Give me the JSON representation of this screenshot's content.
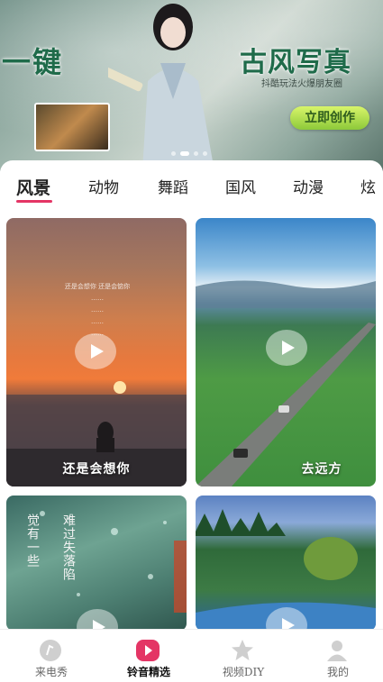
{
  "banner": {
    "title_left": "一键",
    "title_right": "古风写真",
    "subtitle": "抖酷玩法火爆朋友圈",
    "cta": "立即创作",
    "page_index": 2,
    "page_count": 4
  },
  "tabs": [
    {
      "label": "风景",
      "active": true
    },
    {
      "label": "动物",
      "active": false
    },
    {
      "label": "舞蹈",
      "active": false
    },
    {
      "label": "国风",
      "active": false
    },
    {
      "label": "动漫",
      "active": false
    },
    {
      "label": "炫",
      "active": false
    }
  ],
  "cards": [
    {
      "caption": "还是会想你",
      "poem": [
        "还是会想你 还是会惦你",
        "……",
        "……",
        "……",
        "……"
      ]
    },
    {
      "caption": "去远方"
    },
    {
      "caption": "",
      "vertical_text": [
        "难过失落陷",
        "觉有一些"
      ]
    },
    {
      "caption": ""
    }
  ],
  "nav": [
    {
      "label": "来电秀",
      "icon": "ringtone-disc-icon",
      "active": false
    },
    {
      "label": "铃音精选",
      "icon": "play-icon",
      "active": true
    },
    {
      "label": "视频DIY",
      "icon": "star-icon",
      "active": false
    },
    {
      "label": "我的",
      "icon": "user-icon",
      "active": false
    }
  ],
  "colors": {
    "accent": "#e43565",
    "cta_green": "#8dc93a",
    "title_green": "#1f6b4a"
  }
}
